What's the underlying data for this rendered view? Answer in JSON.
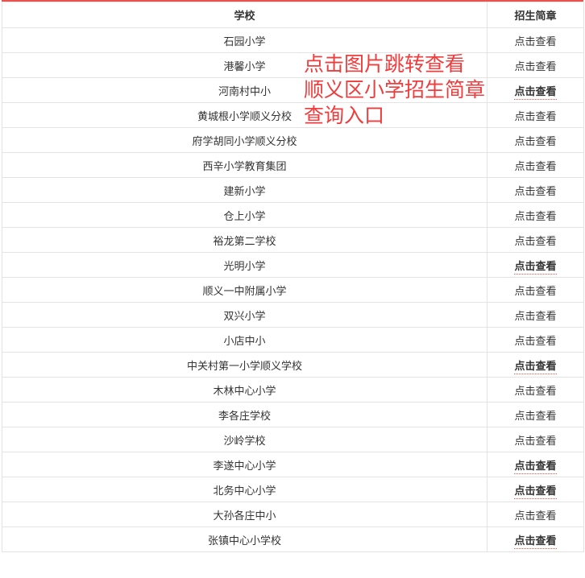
{
  "table": {
    "headers": [
      "学校",
      "招生简章"
    ],
    "rows": [
      {
        "school": "石园小学",
        "link": "点击查看",
        "bold": false
      },
      {
        "school": "港馨小学",
        "link": "点击查看",
        "bold": false
      },
      {
        "school": "河南村中小",
        "link": "点击查看",
        "bold": true
      },
      {
        "school": "黄城根小学顺义分校",
        "link": "点击查看",
        "bold": false
      },
      {
        "school": "府学胡同小学顺义分校",
        "link": "点击查看",
        "bold": false
      },
      {
        "school": "西辛小学教育集团",
        "link": "点击查看",
        "bold": false
      },
      {
        "school": "建新小学",
        "link": "点击查看",
        "bold": false
      },
      {
        "school": "仓上小学",
        "link": "点击查看",
        "bold": false
      },
      {
        "school": "裕龙第二学校",
        "link": "点击查看",
        "bold": false
      },
      {
        "school": "光明小学",
        "link": "点击查看",
        "bold": true
      },
      {
        "school": "顺义一中附属小学",
        "link": "点击查看",
        "bold": false
      },
      {
        "school": "双兴小学",
        "link": "点击查看",
        "bold": false
      },
      {
        "school": "小店中小",
        "link": "点击查看",
        "bold": false
      },
      {
        "school": "中关村第一小学顺义学校",
        "link": "点击查看",
        "bold": true
      },
      {
        "school": "木林中心小学",
        "link": "点击查看",
        "bold": false
      },
      {
        "school": "李各庄学校",
        "link": "点击查看",
        "bold": false
      },
      {
        "school": "沙岭学校",
        "link": "点击查看",
        "bold": false
      },
      {
        "school": "李遂中心小学",
        "link": "点击查看",
        "bold": true
      },
      {
        "school": "北务中心小学",
        "link": "点击查看",
        "bold": true
      },
      {
        "school": "大孙各庄中小",
        "link": "点击查看",
        "bold": false
      },
      {
        "school": "张镇中心小学校",
        "link": "点击查看",
        "bold": true
      }
    ]
  },
  "overlay": {
    "lines": [
      "点击图片跳转查看",
      "顺义区小学招生简章",
      "查询入口"
    ],
    "color": "#f03c3c"
  },
  "colors": {
    "accent": "#e8534f",
    "border": "#e3e3e3",
    "text": "#333333"
  }
}
